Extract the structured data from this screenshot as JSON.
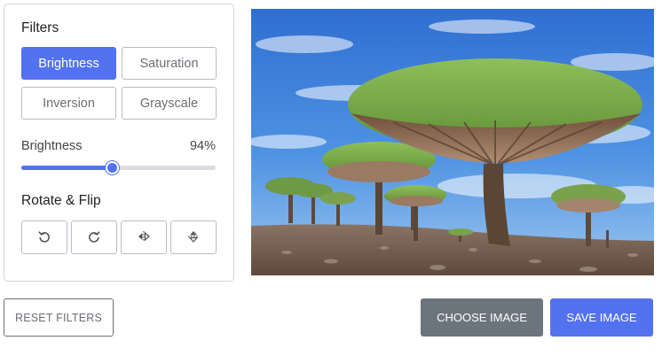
{
  "filters": {
    "title": "Filters",
    "buttons": [
      {
        "label": "Brightness",
        "active": true
      },
      {
        "label": "Saturation",
        "active": false
      },
      {
        "label": "Inversion",
        "active": false
      },
      {
        "label": "Grayscale",
        "active": false
      }
    ],
    "slider": {
      "name": "Brightness",
      "value_label": "94%",
      "fraction": 0.47
    }
  },
  "rotate_flip": {
    "title": "Rotate & Flip",
    "icons": [
      "rotate-left-icon",
      "rotate-right-icon",
      "flip-horizontal-icon",
      "flip-vertical-icon"
    ]
  },
  "preview": {
    "icon": "dragon-blood-tree-photo"
  },
  "actions": {
    "reset_label": "RESET FILTERS",
    "choose_label": "CHOOSE IMAGE",
    "save_label": "SAVE IMAGE"
  },
  "colors": {
    "accent": "#5372f0",
    "secondary": "#6c757d",
    "border": "#b8bdc4"
  }
}
